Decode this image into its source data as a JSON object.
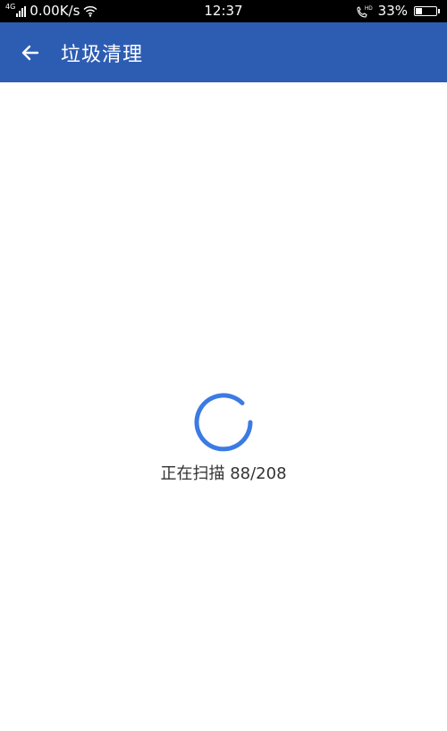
{
  "status_bar": {
    "network_type": "4G",
    "speed": "0.00K/s",
    "time": "12:37",
    "battery": "33%",
    "battery_level": 0.33,
    "icons": [
      "signal-icon",
      "wifi-icon",
      "hd-call-icon",
      "battery-icon"
    ]
  },
  "header": {
    "back_icon": "arrow-left-icon",
    "title": "垃圾清理"
  },
  "scan": {
    "label": "正在扫描",
    "current": 88,
    "total": 208,
    "progress_text": "88/208",
    "spinner_icon": "loading-spinner-icon"
  },
  "colors": {
    "app_bar": "#2d5db3",
    "spinner": "#3b7be3",
    "status_bar": "#000000",
    "background": "#ffffff",
    "text": "#333333"
  }
}
